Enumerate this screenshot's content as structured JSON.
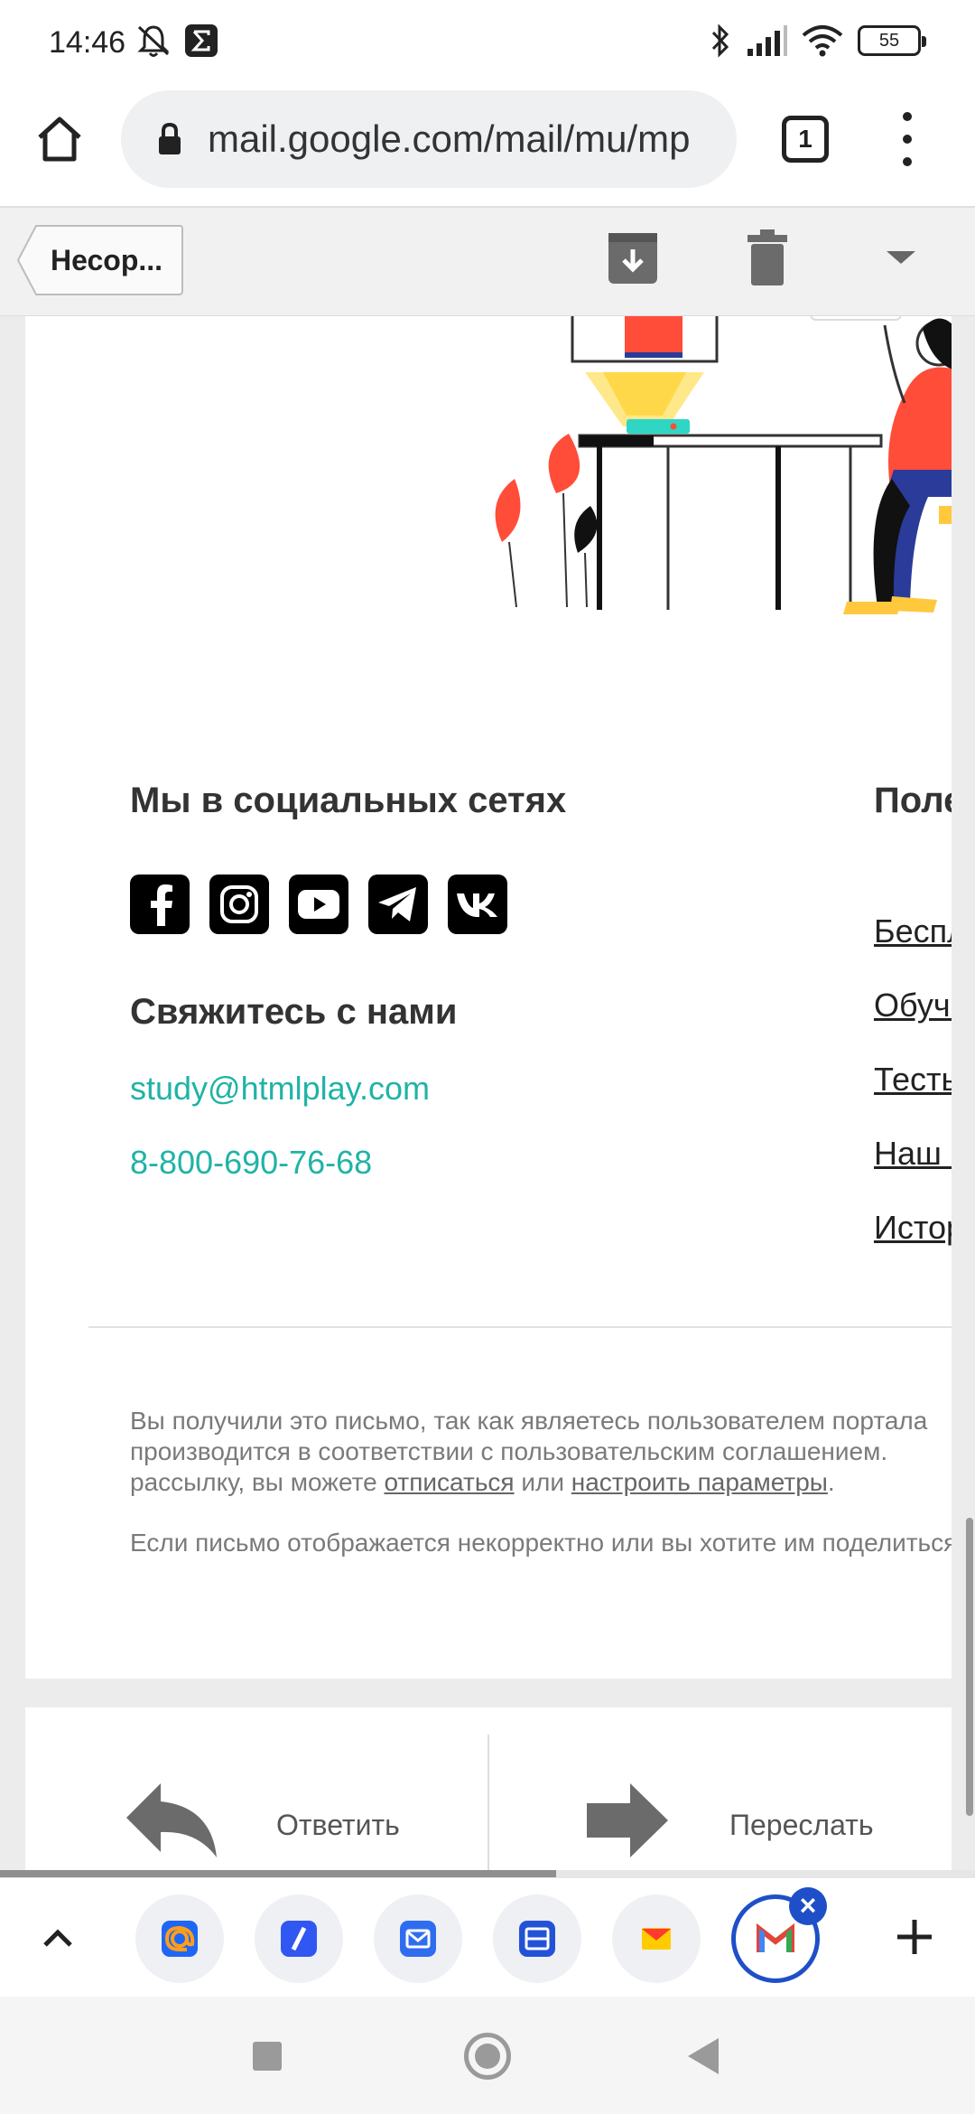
{
  "status_bar": {
    "time": "14:46",
    "battery": "55"
  },
  "browser": {
    "url": "mail.google.com/mail/mu/mp",
    "tab_count": "1"
  },
  "toolbar": {
    "back_label": "Несор..."
  },
  "email": {
    "social_title": "Мы в социальных сетях",
    "useful_title": "Полезные ссылки",
    "contact_title": "Свяжитесь с нами",
    "contact_email": "study@htmlplay.com",
    "contact_phone": "8-800-690-76-68",
    "links": [
      {
        "label": "Бесплатные курсы"
      },
      {
        "label": "Обучающие материалы"
      },
      {
        "label": "Тесты"
      },
      {
        "label": "Наш блог"
      },
      {
        "label": "История"
      }
    ],
    "footer": {
      "line1": "Вы получили это письмо, так как являетесь пользователем портала",
      "line2": "производится в соответствии с пользовательским соглашением.",
      "line3_prefix": "рассылку, вы можете ",
      "unsubscribe": "отписаться",
      "line3_mid": " или ",
      "settings": "настроить параметры",
      "line3_suffix": ".",
      "line4": "Если письмо отображается некорректно или вы хотите им поделиться"
    }
  },
  "actions": {
    "reply": "Ответить",
    "forward": "Переслать"
  },
  "page_progress": 0.57,
  "colors": {
    "accent_teal": "#20b3a6",
    "dock_active": "#1f4fc8"
  },
  "dock": {
    "apps": [
      {
        "icon": "mail-ru-icon"
      },
      {
        "icon": "rambler-icon"
      },
      {
        "icon": "mail-app-icon"
      },
      {
        "icon": "outlook-icon"
      },
      {
        "icon": "yandex-mail-icon"
      },
      {
        "icon": "gmail-icon"
      }
    ]
  }
}
